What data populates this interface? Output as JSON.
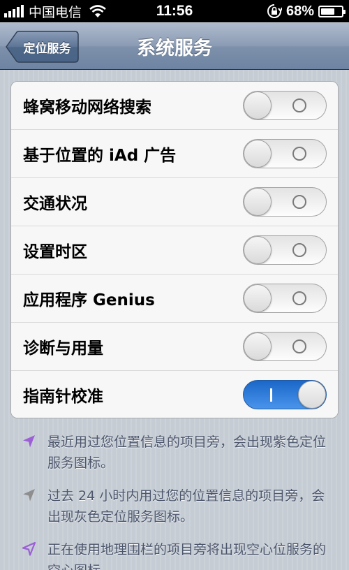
{
  "status_bar": {
    "carrier": "中国电信",
    "time": "11:56",
    "battery_percent": "68%",
    "battery_level": 0.68,
    "icons": [
      "signal-icon",
      "wifi-icon",
      "rotation-lock-icon",
      "battery-icon"
    ]
  },
  "nav_bar": {
    "back_label": "定位服务",
    "title": "系统服务"
  },
  "settings": [
    {
      "label": "蜂窝移动网络搜索",
      "enabled": false
    },
    {
      "label": "基于位置的 iAd 广告",
      "enabled": false
    },
    {
      "label": "交通状况",
      "enabled": false
    },
    {
      "label": "设置时区",
      "enabled": false
    },
    {
      "label": "应用程序 Genius",
      "enabled": false
    },
    {
      "label": "诊断与用量",
      "enabled": false
    },
    {
      "label": "指南针校准",
      "enabled": true
    }
  ],
  "notes": [
    {
      "icon": "location-arrow-purple-icon",
      "text": "最近用过您位置信息的项目旁，会出现紫色定位服务图标。"
    },
    {
      "icon": "location-arrow-gray-icon",
      "text": "过去 24 小时内用过您的位置信息的项目旁，会出现灰色定位服务图标。"
    },
    {
      "icon": "location-arrow-outline-icon",
      "text": "正在使用地理围栏的项目旁将出现空心位服务的空心图标。"
    }
  ],
  "colors": {
    "nav_bar": "#7e90ab",
    "toggle_on": "#2f7fdb",
    "purple_arrow": "#9b5fd6",
    "gray_arrow": "#8e8e8e",
    "note_text": "#4c566c",
    "background": "#c5ccd4"
  }
}
